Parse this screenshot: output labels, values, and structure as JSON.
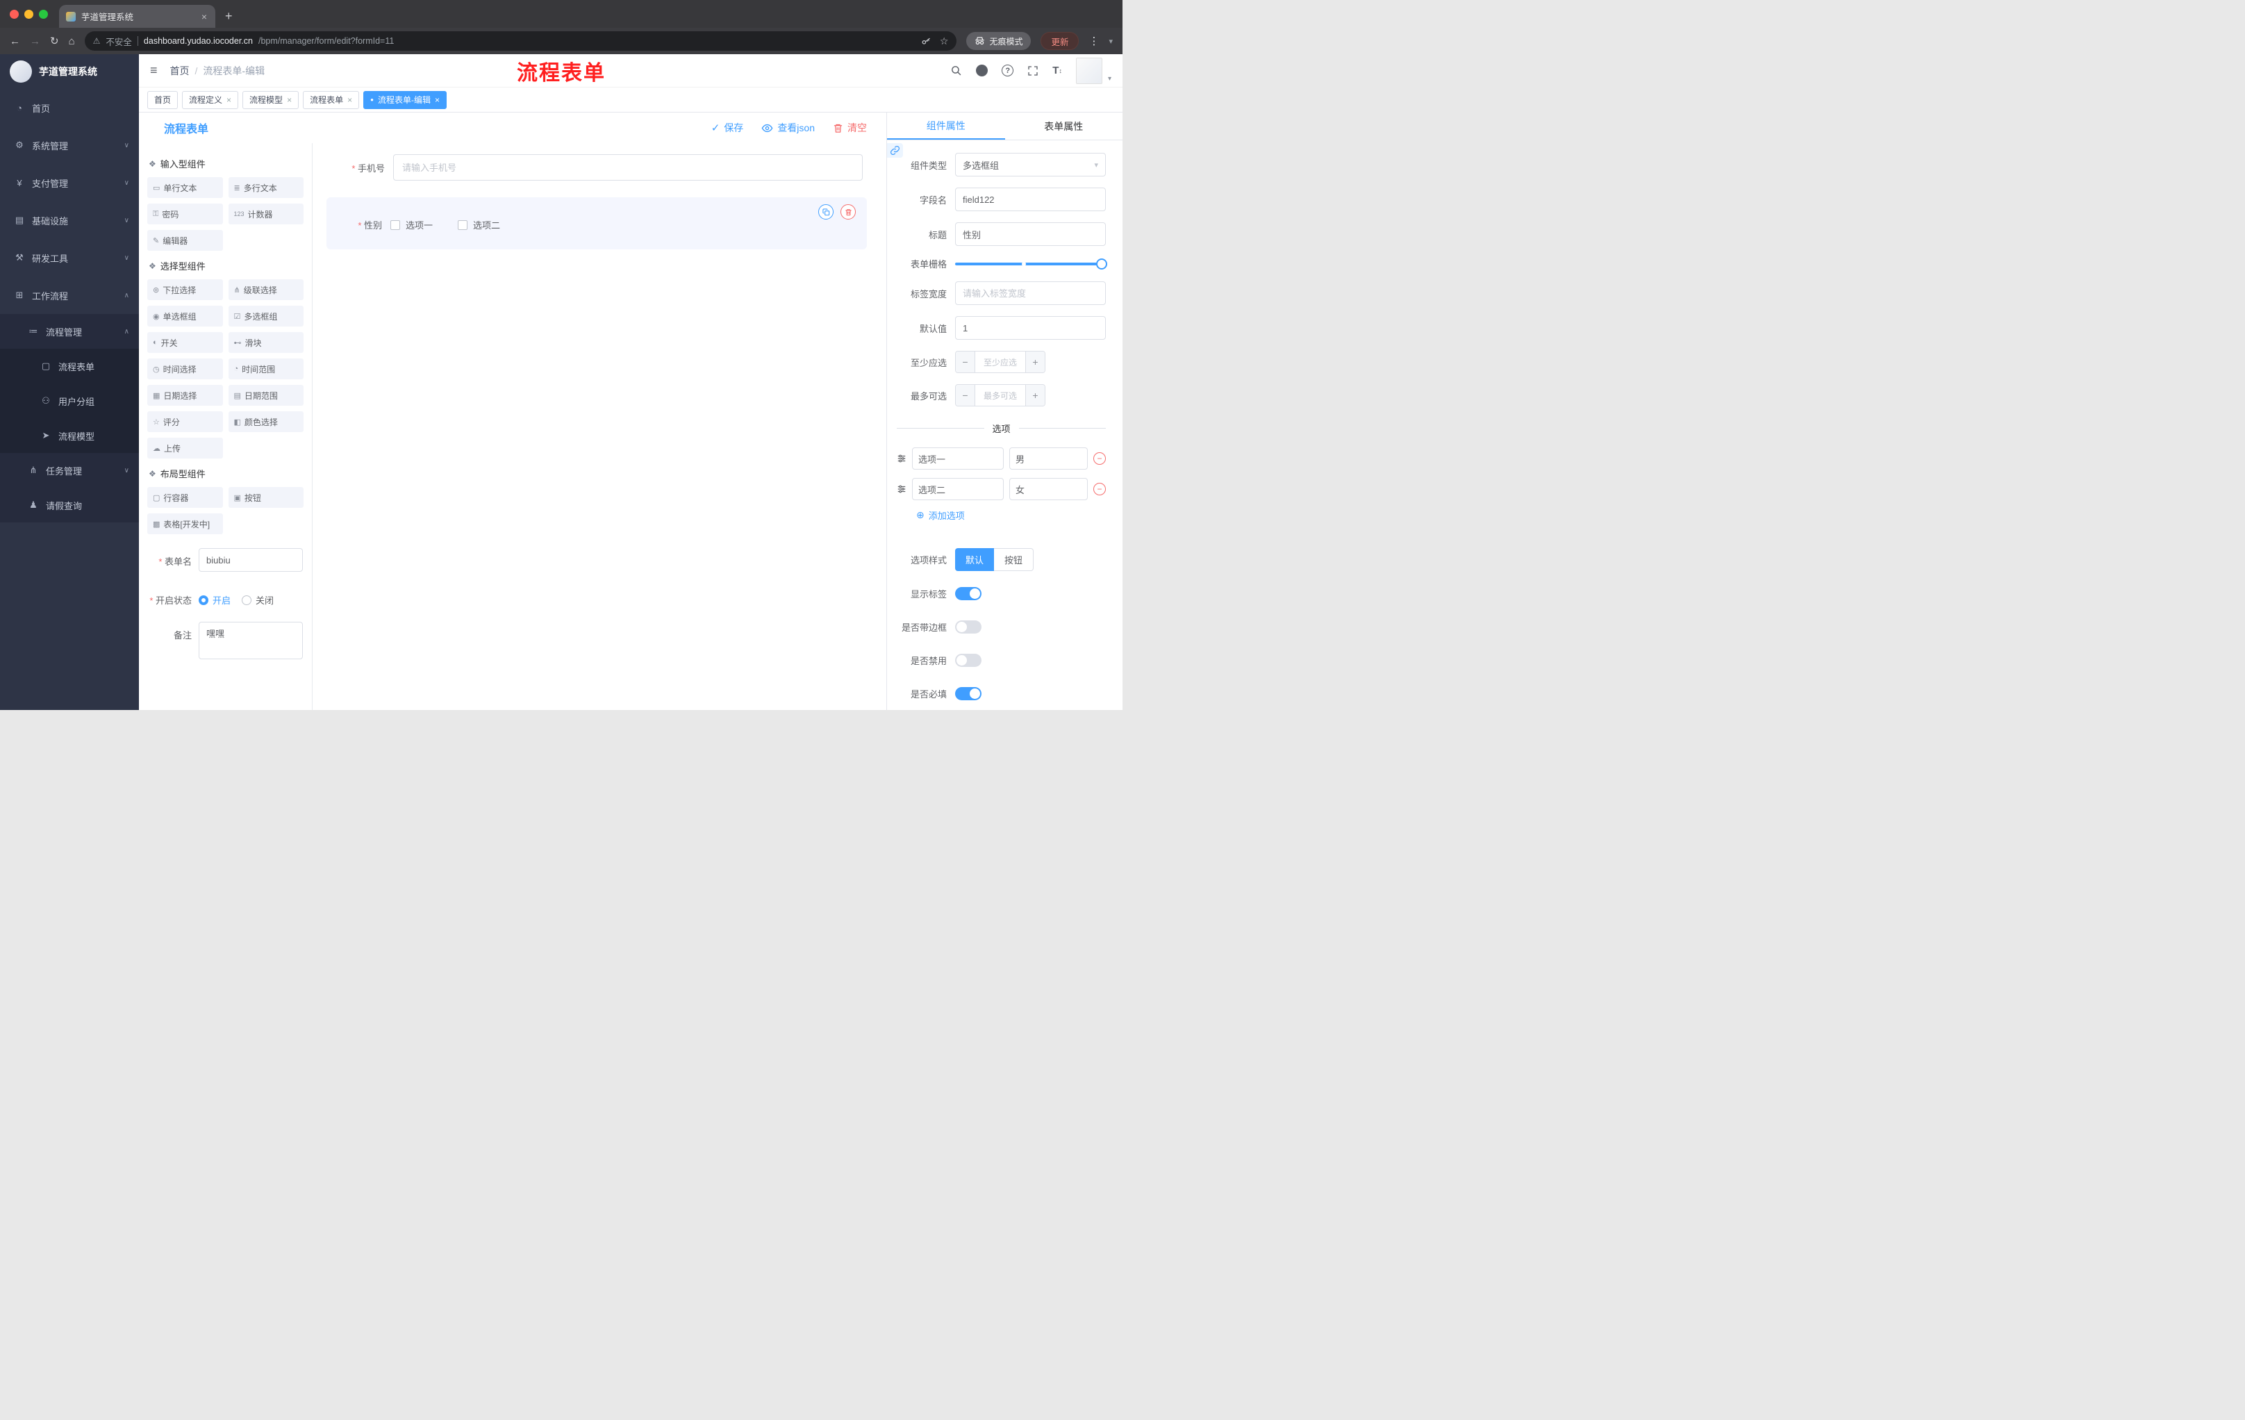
{
  "colors": {
    "accent": "#409eff",
    "danger": "#f56c6c",
    "sidebar_bg": "#2e3446"
  },
  "glyphs": {
    "back": "←",
    "forward": "→",
    "reload": "↻",
    "home": "⌂",
    "warning": "⚠",
    "star": "☆",
    "menu_dots": "⋮",
    "caret_down": "▾",
    "new_tab": "+",
    "close": "×",
    "hamburger": "≡",
    "slash": "/",
    "check": "✓",
    "tag_dot": "●",
    "chev_down": "∨",
    "chev_up": "∧",
    "section": "❖",
    "plus_circle": "⊕",
    "minus": "−",
    "plus": "+",
    "question": "?",
    "font_t": "T",
    "updown": "↕"
  },
  "browser": {
    "tab_title": "芋道管理系统",
    "security": "不安全",
    "url_domain": "dashboard.yudao.iocoder.cn",
    "url_path": "/bpm/manager/form/edit?formId=11",
    "incognito": "无痕模式",
    "update": "更新"
  },
  "header": {
    "logo_title": "芋道管理系统",
    "breadcrumb_home": "首页",
    "breadcrumb_current": "流程表单-编辑",
    "annotation": "流程表单"
  },
  "tags": {
    "items": [
      {
        "label": "首页"
      },
      {
        "label": "流程定义"
      },
      {
        "label": "流程模型"
      },
      {
        "label": "流程表单"
      },
      {
        "label": "流程表单-编辑"
      }
    ]
  },
  "sidebar": {
    "labels": {
      "home": "首页",
      "system": "系统管理",
      "pay": "支付管理",
      "infra": "基础设施",
      "dev": "研发工具",
      "workflow": "工作流程",
      "process_mgmt": "流程管理",
      "process_form": "流程表单",
      "user_group": "用户分组",
      "process_model": "流程模型",
      "task_mgmt": "任务管理",
      "leave_query": "请假查询"
    },
    "icons": {
      "home": "◔",
      "system": "⚙",
      "pay": "¥",
      "infra": "▤",
      "dev": "⚒",
      "workflow": "⊞",
      "process_mgmt": "≔",
      "process_form": "▢",
      "user_group": "⚇",
      "process_model": "➤",
      "task_mgmt": "⋔",
      "leave_query": "♟"
    }
  },
  "toolbar": {
    "title": "流程表单",
    "save": "保存",
    "view_json": "查看json",
    "clear": "清空"
  },
  "palette": {
    "sections": [
      {
        "title": "输入型组件",
        "items": [
          {
            "label": "单行文本",
            "icon": "▭"
          },
          {
            "label": "多行文本",
            "icon": "≣"
          },
          {
            "label": "密码",
            "icon": "⚿"
          },
          {
            "label": "计数器",
            "icon": "123"
          },
          {
            "label": "编辑器",
            "icon": "✎"
          }
        ]
      },
      {
        "title": "选择型组件",
        "items": [
          {
            "label": "下拉选择",
            "icon": "⊚"
          },
          {
            "label": "级联选择",
            "icon": "⋔"
          },
          {
            "label": "单选框组",
            "icon": "◉"
          },
          {
            "label": "多选框组",
            "icon": "☑"
          },
          {
            "label": "开关",
            "icon": "◐"
          },
          {
            "label": "滑块",
            "icon": "⊷"
          },
          {
            "label": "时间选择",
            "icon": "◷"
          },
          {
            "label": "时间范围",
            "icon": "◔"
          },
          {
            "label": "日期选择",
            "icon": "▦"
          },
          {
            "label": "日期范围",
            "icon": "▤"
          },
          {
            "label": "评分",
            "icon": "☆"
          },
          {
            "label": "颜色选择",
            "icon": "◧"
          },
          {
            "label": "上传",
            "icon": "☁"
          }
        ]
      },
      {
        "title": "布局型组件",
        "items": [
          {
            "label": "行容器",
            "icon": "▢"
          },
          {
            "label": "按钮",
            "icon": "▣"
          },
          {
            "label": "表格[开发中]",
            "icon": "▩"
          }
        ]
      }
    ],
    "form": {
      "name_label": "表单名",
      "name_value": "biubiu",
      "status_label": "开启状态",
      "on_label": "开启",
      "off_label": "关闭",
      "remark_label": "备注",
      "remark_value": "嘿嘿"
    }
  },
  "canvas": {
    "phone_label": "手机号",
    "phone_placeholder": "请输入手机号",
    "gender_label": "性别",
    "opt1": "选项一",
    "opt2": "选项二"
  },
  "panel": {
    "tab_component": "组件属性",
    "tab_form": "表单属性",
    "type_label": "组件类型",
    "type_value": "多选框组",
    "field_label": "字段名",
    "field_value": "field122",
    "title_label": "标题",
    "title_value": "性别",
    "grid_label": "表单栅格",
    "width_label": "标签宽度",
    "width_placeholder": "请输入标签宽度",
    "default_label": "默认值",
    "default_value": "1",
    "min_label": "至少应选",
    "min_placeholder": "至少应选",
    "max_label": "最多可选",
    "max_placeholder": "最多可选",
    "options_title": "选项",
    "options": [
      {
        "label": "选项一",
        "value": "男"
      },
      {
        "label": "选项二",
        "value": "女"
      }
    ],
    "add_option": "添加选项",
    "style_label": "选项样式",
    "style_default": "默认",
    "style_button": "按钮",
    "show_label": "显示标签",
    "border_label": "是否带边框",
    "disabled_label": "是否禁用",
    "required_label": "是否必填"
  }
}
